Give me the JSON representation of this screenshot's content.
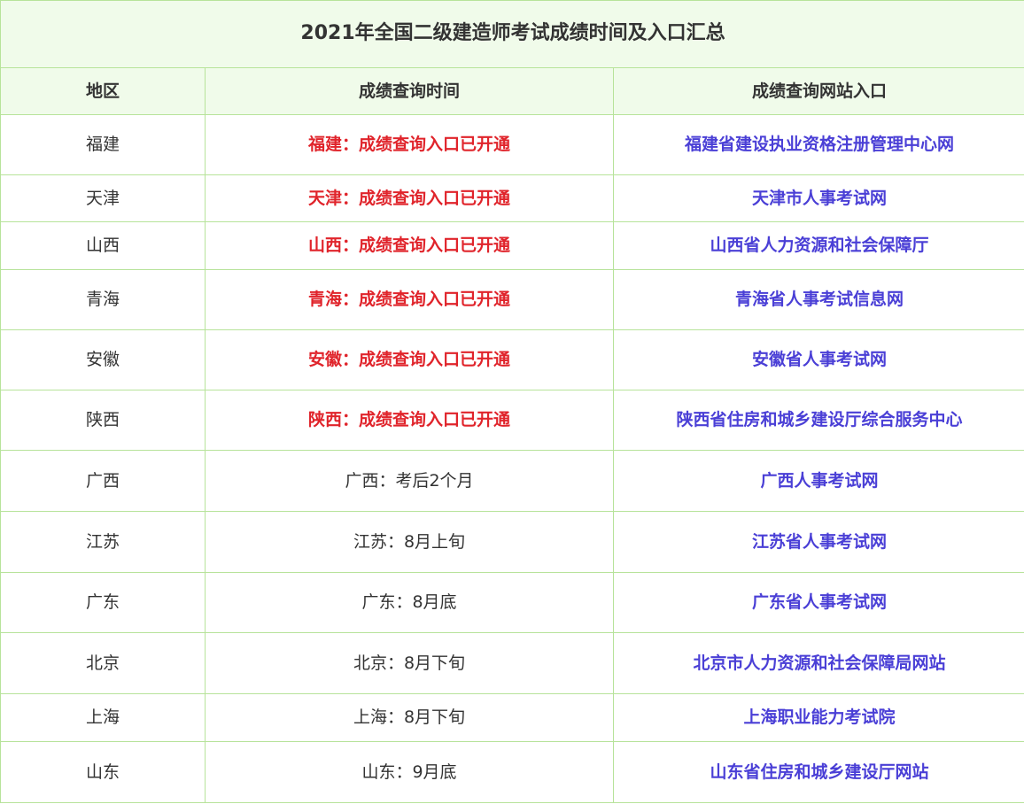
{
  "table": {
    "title": "2021年全国二级建造师考试成绩时间及入口汇总",
    "headers": [
      "地区",
      "成绩查询时间",
      "成绩查询网站入口"
    ],
    "colors": {
      "border": "#b7e39a",
      "header_bg": "#f0fbea",
      "open_text": "#e0242b",
      "link_text": "#4a3fd6"
    },
    "rows": [
      {
        "region": "福建",
        "time": "福建：成绩查询入口已开通",
        "open": true,
        "link": "福建省建设执业资格注册管理中心网"
      },
      {
        "region": "天津",
        "time": "天津：成绩查询入口已开通",
        "open": true,
        "link": "天津市人事考试网"
      },
      {
        "region": "山西",
        "time": "山西：成绩查询入口已开通",
        "open": true,
        "link": "山西省人力资源和社会保障厅"
      },
      {
        "region": "青海",
        "time": "青海：成绩查询入口已开通",
        "open": true,
        "link": "青海省人事考试信息网"
      },
      {
        "region": "安徽",
        "time": "安徽：成绩查询入口已开通",
        "open": true,
        "link": "安徽省人事考试网"
      },
      {
        "region": "陕西",
        "time": "陕西：成绩查询入口已开通",
        "open": true,
        "link": "陕西省住房和城乡建设厅综合服务中心"
      },
      {
        "region": "广西",
        "time": "广西：考后2个月",
        "open": false,
        "link": "广西人事考试网"
      },
      {
        "region": "江苏",
        "time": "江苏：8月上旬",
        "open": false,
        "link": "江苏省人事考试网"
      },
      {
        "region": "广东",
        "time": "广东：8月底",
        "open": false,
        "link": "广东省人事考试网"
      },
      {
        "region": "北京",
        "time": "北京：8月下旬",
        "open": false,
        "link": "北京市人力资源和社会保障局网站"
      },
      {
        "region": "上海",
        "time": "上海：8月下旬",
        "open": false,
        "link": "上海职业能力考试院"
      },
      {
        "region": "山东",
        "time": "山东：9月底",
        "open": false,
        "link": "山东省住房和城乡建设厅网站"
      }
    ]
  }
}
